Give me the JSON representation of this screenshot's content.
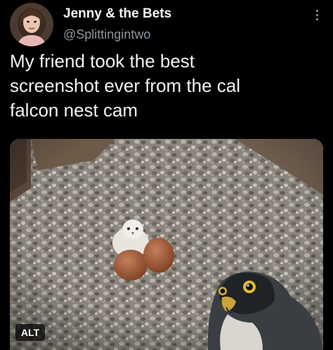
{
  "tweet": {
    "author_name": "Jenny & the Bets",
    "author_handle": "@Splittingintwo",
    "text_lines": [
      "My friend took the best",
      "screenshot ever from the cal",
      "falcon nest cam"
    ],
    "media": {
      "alt_badge": "ALT"
    }
  },
  "icons": {
    "more": "more-vertical-icon"
  },
  "colors": {
    "background": "#000000",
    "name": "#f5f5f5",
    "handle": "#8b98a5",
    "text": "#f2f2f2"
  }
}
